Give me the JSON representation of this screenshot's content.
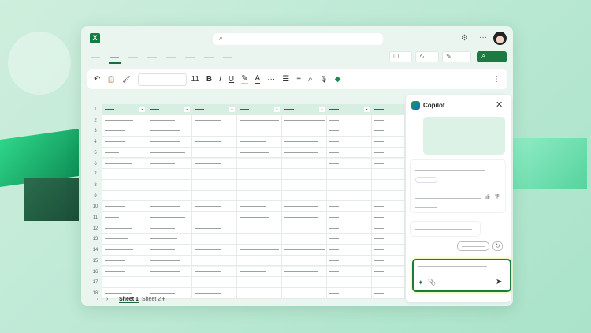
{
  "app": {
    "icon_letter": "X",
    "search_icon": "⌕",
    "settings_icon": "⚙",
    "more_icon": "···"
  },
  "ribbon_actions": {
    "comments_icon": "☐",
    "catchup_icon": "∿",
    "editing_icon": "✎",
    "share_icon": "♙"
  },
  "toolbar": {
    "undo": "↶",
    "paste": "📋",
    "painter": "🖌",
    "font_size": "11",
    "bold": "B",
    "italic": "I",
    "underline": "U",
    "highlight": "✎",
    "font_color": "A",
    "more": "···",
    "list": "☰",
    "align": "≡",
    "find": "⌕",
    "mic": "🎙",
    "copilot": "◆",
    "overflow": "⋮"
  },
  "rows": [
    "1",
    "2",
    "3",
    "4",
    "5",
    "6",
    "7",
    "8",
    "9",
    "10",
    "11",
    "12",
    "13",
    "14",
    "15",
    "16",
    "17",
    "18"
  ],
  "sheets": {
    "prev": "‹",
    "next": "›",
    "tabs": [
      "Sheet 1",
      "Sheet 2"
    ],
    "add": "+"
  },
  "copilot": {
    "title": "Copilot",
    "close": "✕",
    "attach": "📎",
    "sparkle": "✦",
    "send": "➤",
    "refresh": "↻",
    "thumbs_up": "👍",
    "thumbs_down": "👎"
  },
  "colors": {
    "accent": "#107c41",
    "header_fill": "#d7eee2"
  }
}
